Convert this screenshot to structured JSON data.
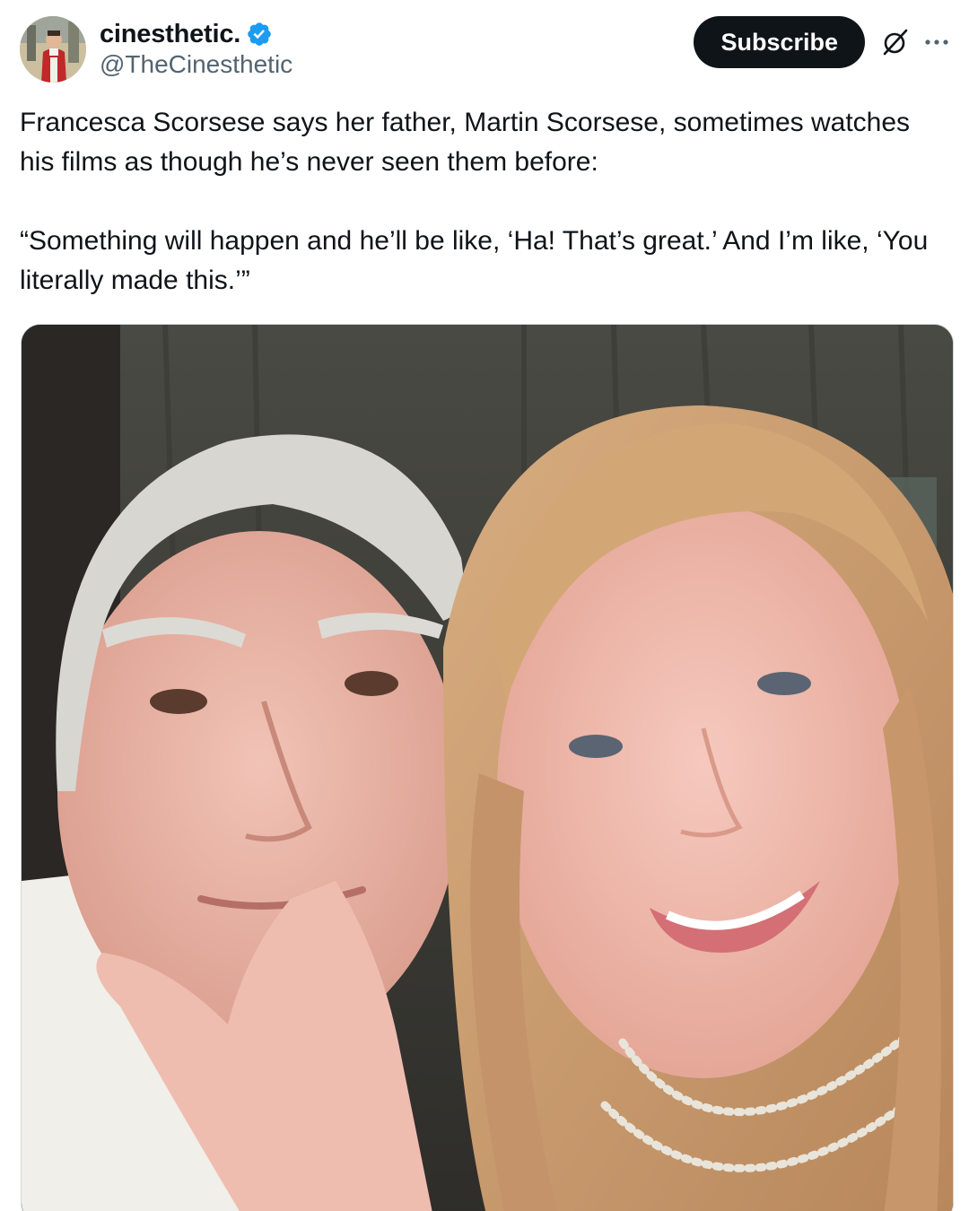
{
  "author": {
    "display_name": "cinesthetic.",
    "handle": "@TheCinesthetic",
    "verified": true,
    "verified_icon": "verified-badge-icon",
    "avatar_icon": "avatar"
  },
  "header_actions": {
    "subscribe_label": "Subscribe",
    "grok_icon": "grok-icon",
    "more_icon": "more-icon"
  },
  "tweet": {
    "paragraph_1": "Francesca Scorsese says her father, Martin Scorsese, sometimes watches his films as though he’s never seen them before:",
    "paragraph_2": "“Something will happen and he’ll be like, ‘Ha! That’s great.’ And I’m like, ‘You literally made this.’”"
  },
  "media": {
    "kind": "photo"
  },
  "colors": {
    "text_primary": "#0f1419",
    "text_secondary": "#536471",
    "verified_blue": "#1d9bf0",
    "button_bg": "#0f1419",
    "button_text": "#ffffff"
  }
}
